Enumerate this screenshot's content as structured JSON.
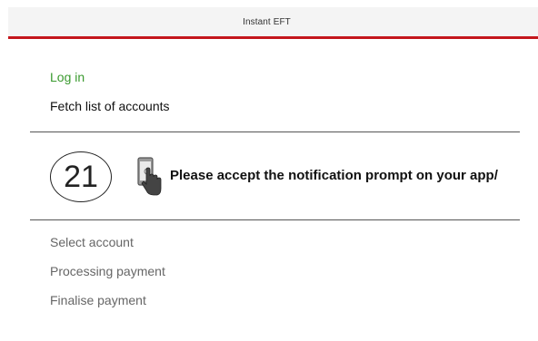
{
  "header": {
    "title": "Instant EFT"
  },
  "steps": {
    "login": "Log in",
    "fetch_accounts": "Fetch list of accounts",
    "select_account": "Select account",
    "processing_payment": "Processing payment",
    "finalise_payment": "Finalise payment"
  },
  "prompt": {
    "countdown": "21",
    "message": "Please accept the notification prompt on your app/",
    "icon": "phone-tap-icon"
  },
  "colors": {
    "header_accent": "#c4161c",
    "completed_step": "#3a9a2f",
    "upcoming_step": "#666666"
  }
}
